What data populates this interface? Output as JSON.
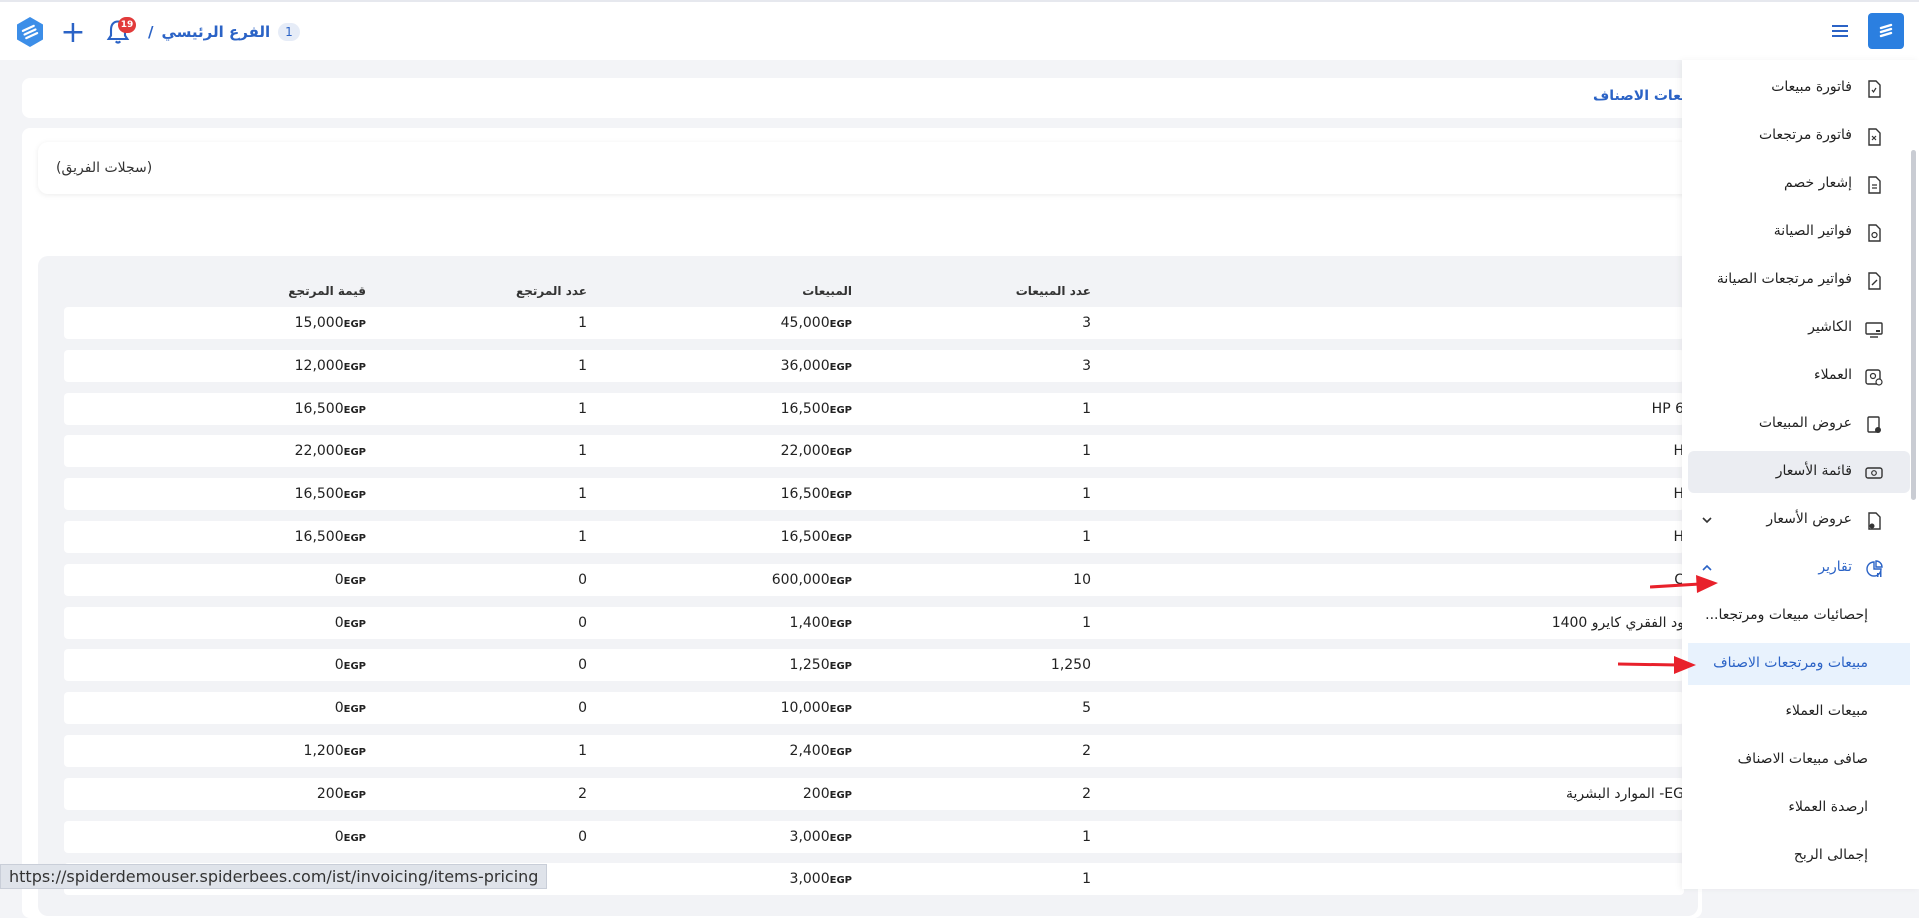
{
  "topbar": {
    "branch_name": "الفرع الرئيسي",
    "branch_count": "1",
    "separator": "/",
    "notification_count": "19"
  },
  "breadcrumb": {
    "current": "جعات الاصناف"
  },
  "filter": {
    "text": "(سجلات الفريق)"
  },
  "table": {
    "headers": {
      "return_value": "قيمة المرتجع",
      "return_count": "عدد المرتجع",
      "sales": "المبيعات",
      "sales_count": "عدد المبيعات"
    },
    "currency": "EGP",
    "rows": [
      {
        "return_value": "15,000",
        "return_count": "1",
        "sales": "45,000",
        "sales_count": "3",
        "name": ""
      },
      {
        "return_value": "12,000",
        "return_count": "1",
        "sales": "36,000",
        "sales_count": "3",
        "name": ""
      },
      {
        "return_value": "16,500",
        "return_count": "1",
        "sales": "16,500",
        "sales_count": "1",
        "name": "HP 6"
      },
      {
        "return_value": "22,000",
        "return_count": "1",
        "sales": "22,000",
        "sales_count": "1",
        "name": "H"
      },
      {
        "return_value": "16,500",
        "return_count": "1",
        "sales": "16,500",
        "sales_count": "1",
        "name": "H"
      },
      {
        "return_value": "16,500",
        "return_count": "1",
        "sales": "16,500",
        "sales_count": "1",
        "name": "H"
      },
      {
        "return_value": "0",
        "return_count": "0",
        "sales": "600,000",
        "sales_count": "10",
        "name": "C"
      },
      {
        "return_value": "0",
        "return_count": "0",
        "sales": "1,400",
        "sales_count": "1",
        "name": "ود الفقري كايرو 1400"
      },
      {
        "return_value": "0",
        "return_count": "0",
        "sales": "1,250",
        "sales_count": "1,250",
        "name": ""
      },
      {
        "return_value": "0",
        "return_count": "0",
        "sales": "10,000",
        "sales_count": "5",
        "name": ""
      },
      {
        "return_value": "1,200",
        "return_count": "1",
        "sales": "2,400",
        "sales_count": "2",
        "name": ""
      },
      {
        "return_value": "200",
        "return_count": "2",
        "sales": "200",
        "sales_count": "2",
        "name": "EG- الموارد البشرية"
      },
      {
        "return_value": "0",
        "return_count": "0",
        "sales": "3,000",
        "sales_count": "1",
        "name": ""
      },
      {
        "return_value": "",
        "return_count": "",
        "sales": "3,000",
        "sales_count": "1",
        "name": ""
      }
    ]
  },
  "sidebar": {
    "items": [
      {
        "label": "فاتورة مبيعات"
      },
      {
        "label": "فاتورة مرتجعات"
      },
      {
        "label": "إشعار خصم"
      },
      {
        "label": "فواتير الصيانة"
      },
      {
        "label": "فواتير مرتجعات الصيانة"
      },
      {
        "label": "الكاشير"
      },
      {
        "label": "العملاء"
      },
      {
        "label": "عروض المبيعات"
      },
      {
        "label": "قائمة الأسعار"
      },
      {
        "label": "عروض الأسعار"
      },
      {
        "label": "تقارير"
      }
    ],
    "sub_items": [
      {
        "label": "إحصائيات مبيعات ومرتجعا..."
      },
      {
        "label": "مبيعات ومرتجعات الاصناف"
      },
      {
        "label": "مبيعات العملاء"
      },
      {
        "label": "صافى مبيعات الاصناف"
      },
      {
        "label": "ارصدة العملاء"
      },
      {
        "label": "إجمالى الربح"
      }
    ]
  },
  "status_bar": {
    "url": "https://spiderdemouser.spiderbees.com/ist/invoicing/items-pricing"
  },
  "colors": {
    "accent": "#2b63c6",
    "brand": "#2b7fe0",
    "arrow": "#e8212b",
    "badge": "#e23b3b"
  }
}
